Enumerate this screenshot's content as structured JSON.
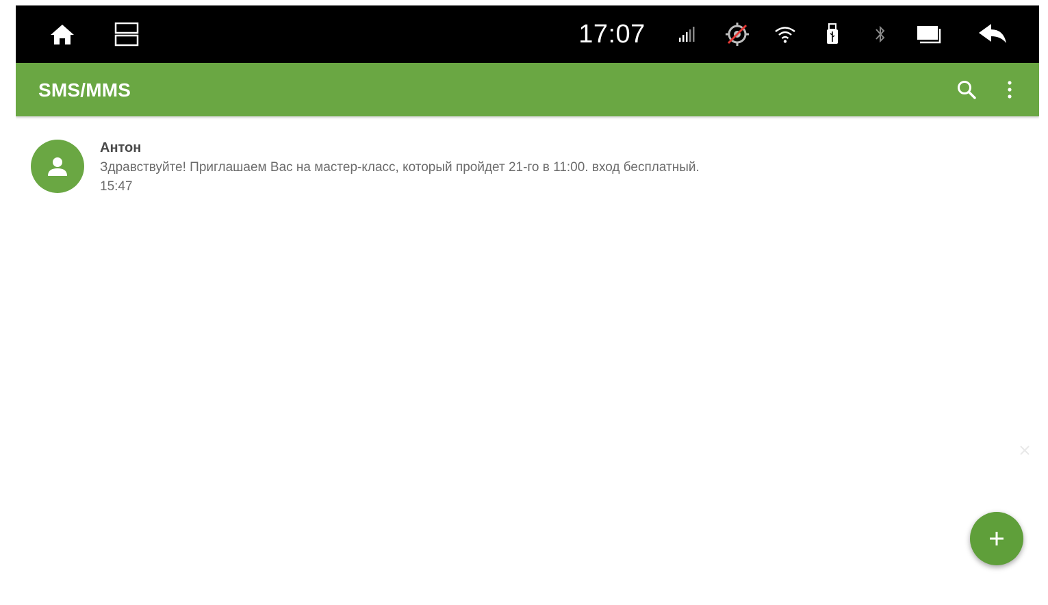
{
  "status_bar": {
    "clock": "17:07",
    "icons": [
      "home-icon",
      "split-screen-icon",
      "signal-icon",
      "gps-off-icon",
      "wifi-icon",
      "usb-icon",
      "bluetooth-icon",
      "screen-icon",
      "back-icon"
    ]
  },
  "app_bar": {
    "title": "SMS/MMS",
    "actions": [
      "search-icon",
      "more-vert-icon"
    ]
  },
  "conversations": [
    {
      "name": "Антон",
      "snippet": "Здравствуйте! Приглашаем Вас на мастер-класс, который пройдет 21-го в 11:00. вход бесплатный.",
      "time": "15:47",
      "avatar_icon": "person-icon"
    }
  ],
  "fab": {
    "icon": "plus-icon"
  },
  "colors": {
    "accent": "#6aa743",
    "status_bar": "#000000",
    "text_primary": "#4a4a4a",
    "text_secondary": "#6b6b6b"
  }
}
